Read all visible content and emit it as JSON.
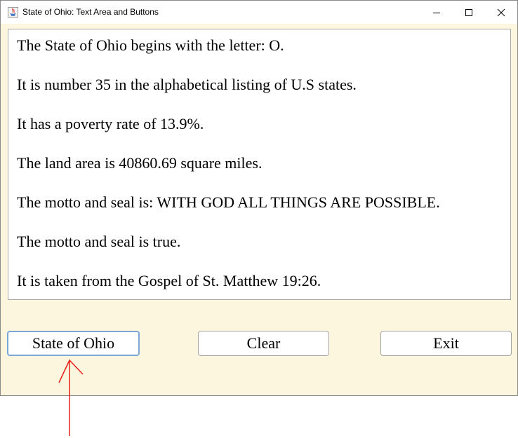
{
  "window": {
    "title": "State of Ohio: Text Area and Buttons",
    "controls": {
      "minimize_icon": "minimize-icon",
      "maximize_icon": "maximize-icon",
      "close_icon": "close-icon"
    }
  },
  "text_area": {
    "lines": [
      "The State of Ohio begins with the letter: O.",
      "It is number 35 in the alphabetical listing of U.S states.",
      "It has a poverty rate of 13.9%.",
      "The land area is 40860.69 square miles.",
      "The motto and seal is: WITH GOD ALL THINGS ARE POSSIBLE.",
      "The motto and seal is true.",
      "It is taken from the Gospel of St. Matthew 19:26."
    ]
  },
  "buttons": {
    "state": "State of Ohio",
    "clear": "Clear",
    "exit": "Exit"
  },
  "colors": {
    "window_background": "#fdf6df",
    "focus_border": "#7aa7d8",
    "annotation_arrow": "#e8201a"
  }
}
